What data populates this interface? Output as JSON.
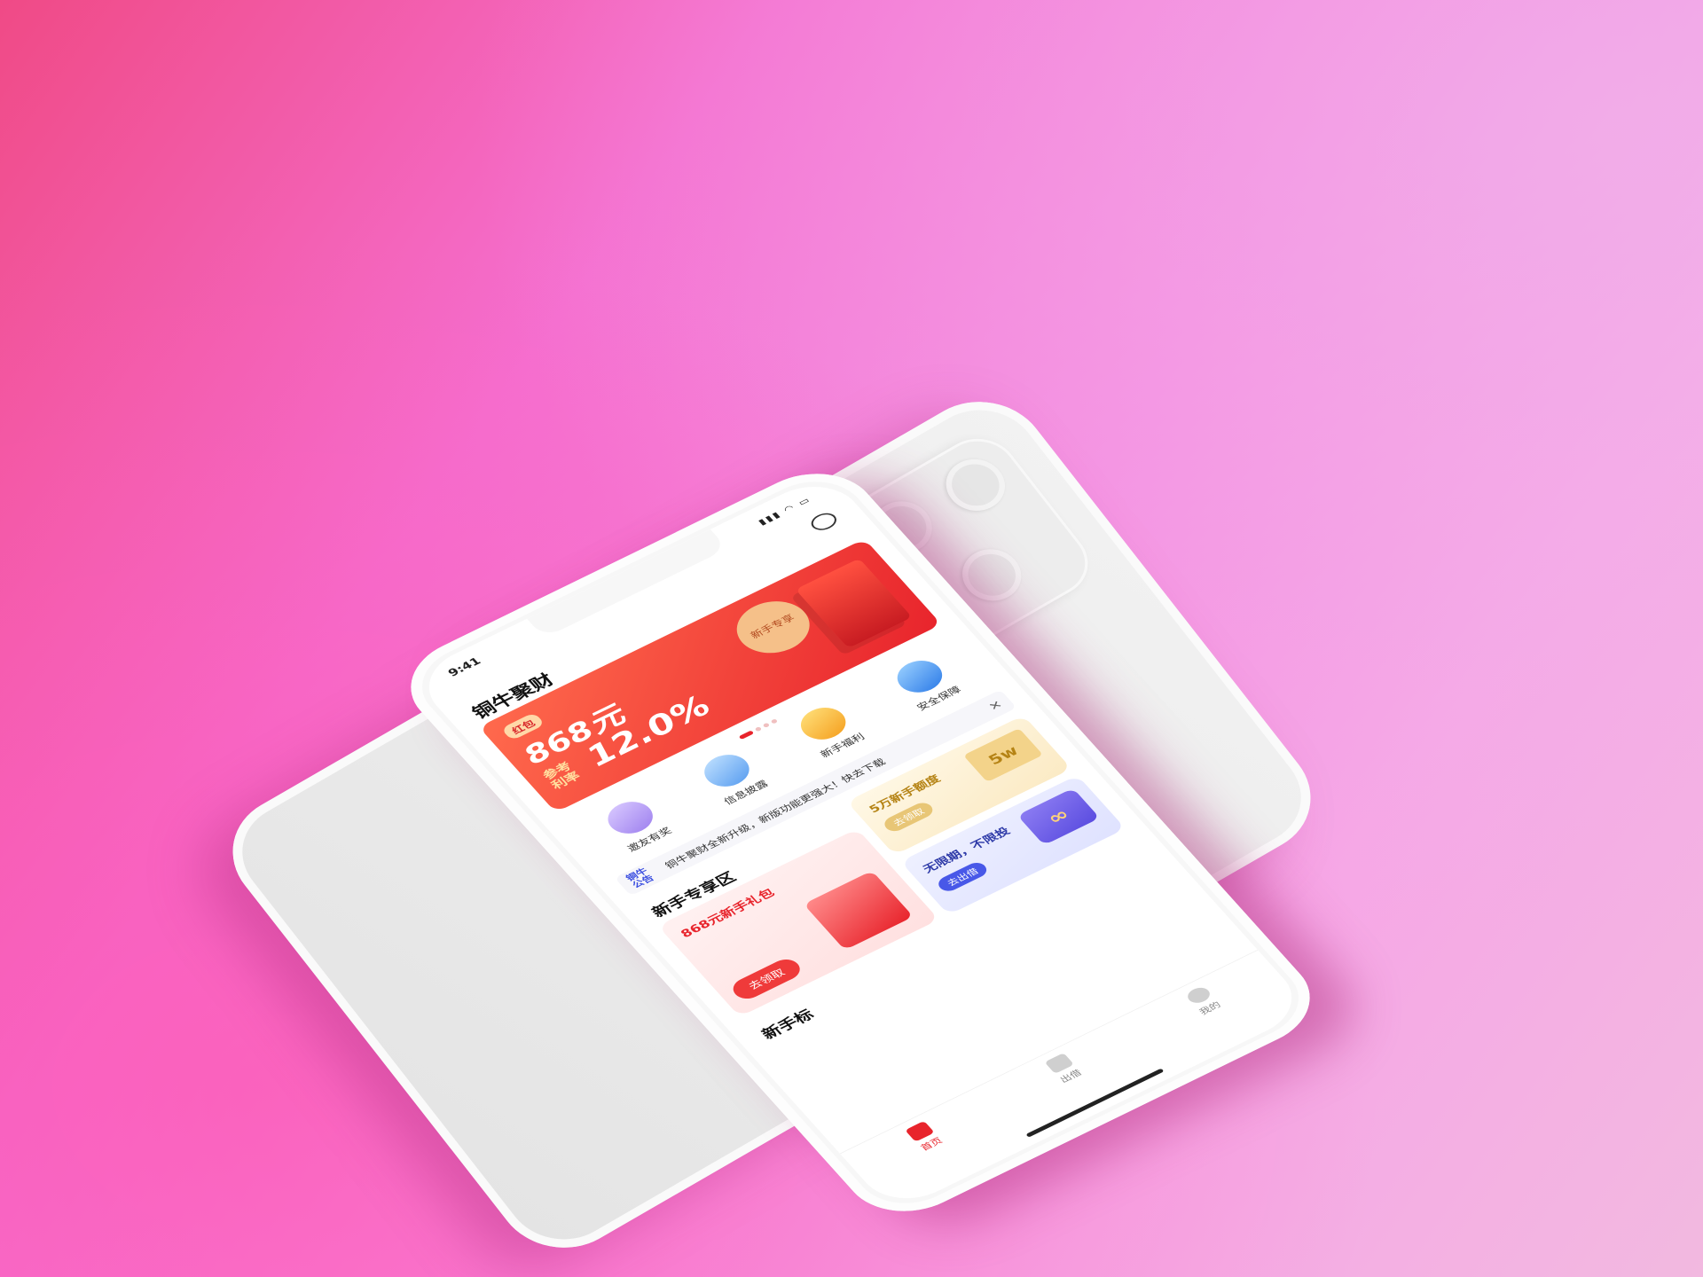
{
  "status": {
    "time": "9:41"
  },
  "app": {
    "title": "铜牛聚财"
  },
  "banner": {
    "tag": "红包",
    "amount": "868元",
    "rate_label": "参考利率",
    "rate": "12.0%",
    "badge": "新手专享"
  },
  "shortcuts": [
    {
      "label": "邀友有奖",
      "icon": "invite-icon",
      "color": "#b89cf5"
    },
    {
      "label": "信息披露",
      "icon": "document-icon",
      "color": "#6aa8f5"
    },
    {
      "label": "新手福利",
      "icon": "gift-icon",
      "color": "#f5b93a"
    },
    {
      "label": "安全保障",
      "icon": "shield-icon",
      "color": "#3f8cf0"
    }
  ],
  "notice": {
    "label": "铜牛公告",
    "text": "铜牛聚财全新升级，新版功能更强大！快去下载",
    "close": "✕"
  },
  "newbie": {
    "title": "新手专享区",
    "gift_card": {
      "title": "868元新手礼包",
      "button": "去领取"
    },
    "quota_card": {
      "title": "5万新手额度",
      "button": "去领取",
      "badge": "5w"
    },
    "unlimited_card": {
      "title": "无限期，不限投",
      "button": "去出借",
      "badge": "∞"
    }
  },
  "section2": {
    "title": "新手标"
  },
  "tabs": [
    {
      "label": "首页",
      "icon": "home-icon",
      "active": true
    },
    {
      "label": "出借",
      "icon": "wallet-icon",
      "active": false
    },
    {
      "label": "我的",
      "icon": "user-icon",
      "active": false
    }
  ]
}
